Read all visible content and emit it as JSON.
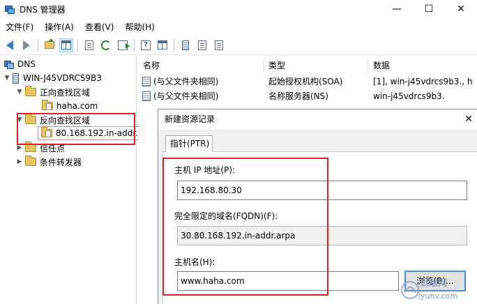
{
  "window": {
    "title": "DNS 管理器"
  },
  "window_controls": [
    "—",
    "☐",
    "✕"
  ],
  "menu": [
    "文件(F)",
    "操作(A)",
    "查看(V)",
    "帮助(H)"
  ],
  "toolbar": {
    "buttons": [
      "back-icon",
      "forward-icon",
      "folder-up-icon",
      "show-hide-tree-icon",
      "properties-icon",
      "refresh-icon",
      "export-list-icon",
      "help-icon",
      "server-icon",
      "record-list-icon",
      "record-view-icon"
    ]
  },
  "tree": {
    "root": "DNS",
    "server": "WIN-J45VDRCS9B3",
    "forward_zone": "正向查找区域",
    "forward_child": "haha.com",
    "reverse_zone": "反向查找区域",
    "reverse_child": "80.168.192.in-addr.",
    "trust_points": "信任点",
    "conditional_forwarders": "条件转发器"
  },
  "list": {
    "columns": [
      "名称",
      "类型",
      "数据"
    ],
    "rows": [
      {
        "name": "(与父文件夹相同)",
        "type": "起始授权机构(SOA)",
        "data": "[1], win-j45vdrcs9b3., h"
      },
      {
        "name": "(与父文件夹相同)",
        "type": "名称服务器(NS)",
        "data": "win-j45vdrcs9b3."
      }
    ]
  },
  "dialog": {
    "title": "新建资源记录",
    "close_glyph": "✕",
    "tab": "指针(PTR)",
    "ip_label": "主机 IP 地址(P):",
    "ip_value": "192.168.80.30",
    "fqdn_label": "完全限定的域名(FQDN)(F):",
    "fqdn_value": "30.80.168.192.in-addr.arpa",
    "host_label": "主机名(H):",
    "host_value": "www.haha.com",
    "browse_button": "浏览(B)..."
  },
  "watermark": {
    "text": "运维网",
    "sub": "iyunv.com"
  },
  "colors": {
    "highlight_box": "#e02020",
    "accent": "#4a8fd8"
  }
}
